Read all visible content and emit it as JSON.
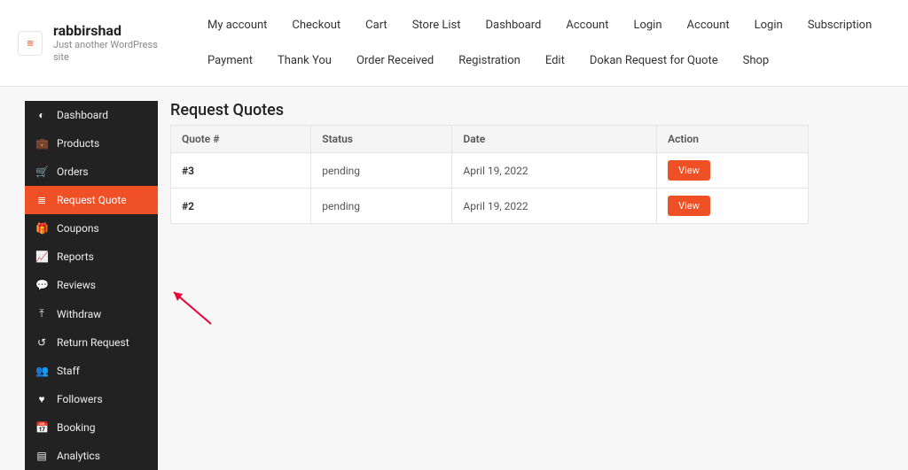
{
  "brand": {
    "title": "rabbirshad",
    "tagline": "Just another WordPress site"
  },
  "topnav": [
    "My account",
    "Checkout",
    "Cart",
    "Store List",
    "Dashboard",
    "Account",
    "Login",
    "Account",
    "Login",
    "Subscription",
    "Payment",
    "Thank You",
    "Order Received",
    "Registration",
    "Edit",
    "Dokan Request for Quote",
    "Shop"
  ],
  "sidebar": {
    "active_index": 3,
    "items": [
      {
        "label": "Dashboard",
        "icon": "dashboard"
      },
      {
        "label": "Products",
        "icon": "briefcase"
      },
      {
        "label": "Orders",
        "icon": "cart"
      },
      {
        "label": "Request Quote",
        "icon": "list"
      },
      {
        "label": "Coupons",
        "icon": "gift"
      },
      {
        "label": "Reports",
        "icon": "chart"
      },
      {
        "label": "Reviews",
        "icon": "comments"
      },
      {
        "label": "Withdraw",
        "icon": "upload"
      },
      {
        "label": "Return Request",
        "icon": "undo"
      },
      {
        "label": "Staff",
        "icon": "users"
      },
      {
        "label": "Followers",
        "icon": "heart"
      },
      {
        "label": "Booking",
        "icon": "calendar"
      },
      {
        "label": "Analytics",
        "icon": "bars"
      }
    ]
  },
  "page": {
    "title": "Request Quotes",
    "columns": [
      "Quote #",
      "Status",
      "Date",
      "Action"
    ],
    "rows": [
      {
        "quote": "#3",
        "status": "pending",
        "date": "April 19, 2022",
        "action": "View"
      },
      {
        "quote": "#2",
        "status": "pending",
        "date": "April 19, 2022",
        "action": "View"
      }
    ]
  },
  "colors": {
    "accent": "#f05025",
    "sidebar": "#222222"
  },
  "icons": {
    "dashboard": "◐",
    "briefcase": "💼",
    "cart": "🛒",
    "list": "≣",
    "gift": "🎁",
    "chart": "📈",
    "comments": "💬",
    "upload": "⤒",
    "undo": "↺",
    "users": "👥",
    "heart": "♥",
    "calendar": "📅",
    "bars": "▤",
    "menu": "≡"
  }
}
